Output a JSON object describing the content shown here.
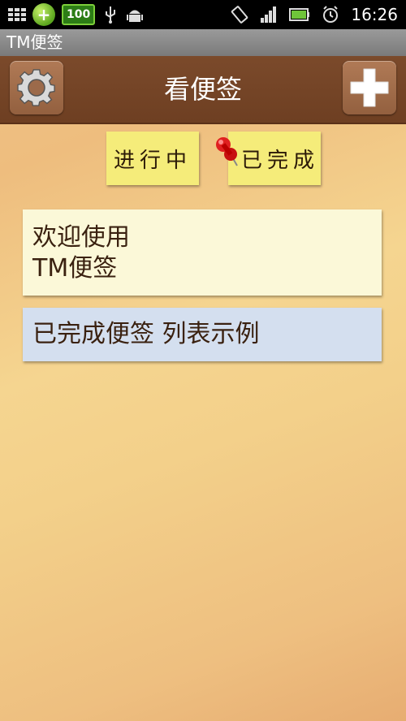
{
  "status_bar": {
    "battery_level": "100",
    "time": "16:26"
  },
  "app_title": "TM便签",
  "header": {
    "title": "看便签",
    "settings_icon": "gear-icon",
    "add_icon": "plus-icon"
  },
  "tabs": [
    {
      "label": "进行中"
    },
    {
      "label": "已完成"
    }
  ],
  "notes": [
    {
      "line1": "欢迎使用",
      "line2": "TM便签",
      "color": "#fbf8d8"
    },
    {
      "line1": "已完成便签 列表示例",
      "color": "#d4dfef"
    }
  ],
  "colors": {
    "header_bg": "#7b4a2b",
    "sticky_yellow": "#f5ec7a",
    "pin_red": "#d81818"
  }
}
